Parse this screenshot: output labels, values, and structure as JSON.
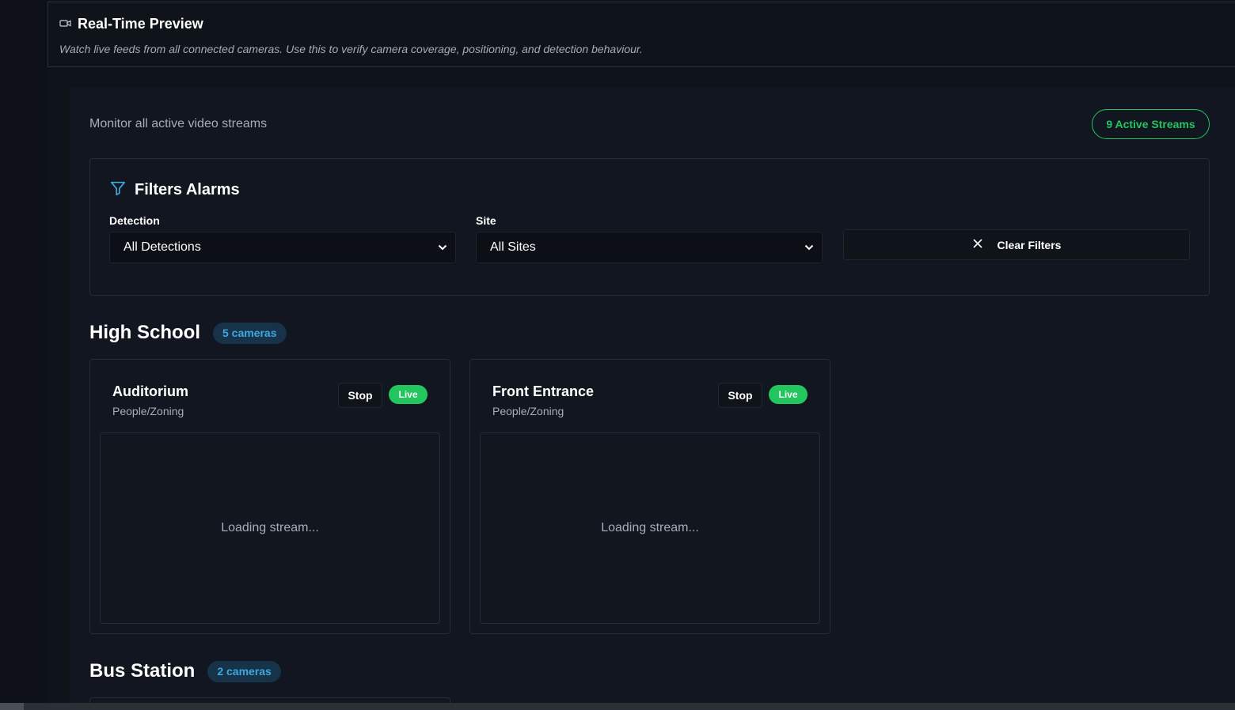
{
  "header": {
    "title": "Real-Time Preview",
    "subtitle": "Watch live feeds from all connected cameras. Use this to verify camera coverage, positioning, and detection behaviour.",
    "icon": "camera-icon"
  },
  "main": {
    "monitor_text": "Monitor all active video streams",
    "active_streams": "9 Active Streams"
  },
  "filters": {
    "title": "Filters Alarms",
    "icon": "filter-icon",
    "detection_label": "Detection",
    "detection_value": "All Detections",
    "site_label": "Site",
    "site_value": "All Sites",
    "clear_label": "Clear Filters"
  },
  "groups": [
    {
      "title": "High School",
      "count": "5 cameras",
      "cameras": [
        {
          "name": "Auditorium",
          "type": "People/Zoning",
          "stop": "Stop",
          "status": "Live",
          "stream": "Loading stream..."
        },
        {
          "name": "Front Entrance",
          "type": "People/Zoning",
          "stop": "Stop",
          "status": "Live",
          "stream": "Loading stream..."
        }
      ]
    },
    {
      "title": "Bus Station",
      "count": "2 cameras",
      "cameras": []
    }
  ],
  "colors": {
    "accent_green": "#22c55e",
    "accent_blue": "#3fa8dd",
    "background": "#111620"
  }
}
